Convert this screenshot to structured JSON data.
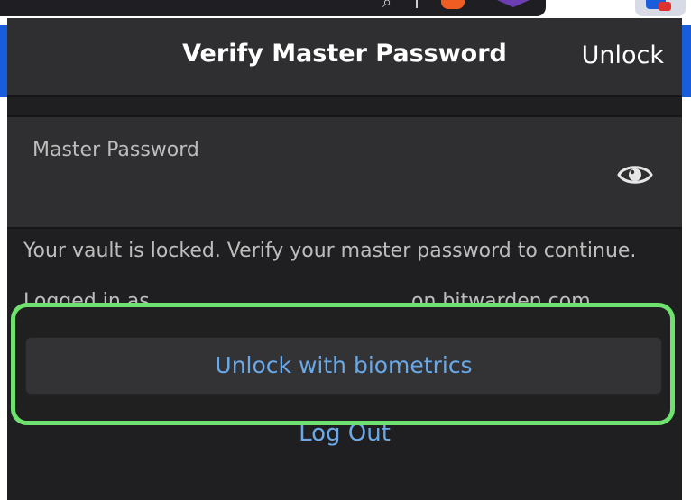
{
  "browser": {
    "address_fragment": "",
    "search_icon": "search-icon"
  },
  "popup": {
    "header": {
      "title": "Verify Master Password",
      "unlock_label": "Unlock"
    },
    "password_field": {
      "label": "Master Password",
      "value": "",
      "eye_icon": "eye-icon"
    },
    "help_text": "Your vault is locked. Verify your master password to continue.",
    "logged_in": {
      "prefix": "Logged in as",
      "suffix": "on bitwarden.com."
    },
    "biometrics_button": "Unlock with biometrics",
    "logout_link": "Log Out",
    "colors": {
      "background": "#1f1f21",
      "header": "#2f2f31",
      "link": "#6aa8e6",
      "highlight": "#6ee16e"
    }
  }
}
